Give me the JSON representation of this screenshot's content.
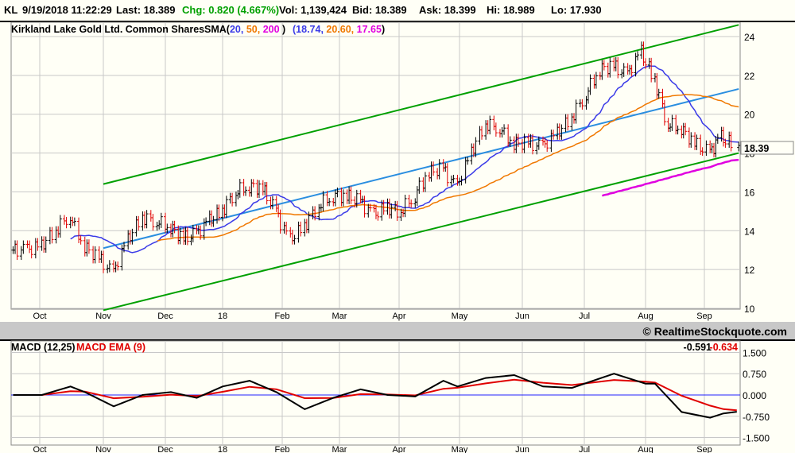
{
  "header": {
    "symbol": "KL",
    "datetime": "9/19/2018 11:22:29",
    "last": "Last: 18.389",
    "chg": "Chg: 0.820 (4.667%)",
    "vol": "Vol: 1,139,424",
    "bid": "Bid: 18.389",
    "ask": "Ask: 18.399",
    "hi": "Hi: 18.989",
    "lo": "Lo: 17.930"
  },
  "colors": {
    "up": "#000000",
    "down": "#e00000",
    "sma20": "#3a3ae8",
    "sma50": "#f07800",
    "sma200": "#e000e0",
    "channel": "#00a000",
    "midline": "#2a8ee0",
    "macd": "#000000",
    "signal": "#e00000",
    "zero": "#2020ff",
    "chg": "#00a000"
  },
  "chart_data": [
    {
      "type": "ohlc",
      "title": "Kirkland Lake Gold Ltd. Common Shares",
      "sma": {
        "label": "SMA(",
        "periods": [
          "20,",
          "50,",
          "200"
        ],
        "close": ")",
        "values": [
          "(18.74,",
          "20.60,",
          "17.65",
          ")"
        ]
      },
      "last_label": "18.39",
      "ylim": [
        10,
        24
      ],
      "yticks": [
        "10",
        "12",
        "14",
        "16",
        "18",
        "20",
        "22",
        "24"
      ],
      "xticks": [
        "Oct",
        "Nov",
        "Dec",
        "18",
        "Feb",
        "Mar",
        "Apr",
        "May",
        "Jun",
        "Jul",
        "Aug",
        "Sep"
      ],
      "weekly_close": {
        "dates": [
          "2017-09-18",
          "2017-09-25",
          "2017-10-02",
          "2017-10-09",
          "2017-10-16",
          "2017-10-23",
          "2017-10-30",
          "2017-11-06",
          "2017-11-13",
          "2017-11-20",
          "2017-11-27",
          "2017-12-04",
          "2017-12-11",
          "2017-12-18",
          "2017-12-25",
          "2018-01-01",
          "2018-01-08",
          "2018-01-15",
          "2018-01-22",
          "2018-01-29",
          "2018-02-05",
          "2018-02-12",
          "2018-02-19",
          "2018-02-26",
          "2018-03-05",
          "2018-03-12",
          "2018-03-19",
          "2018-03-26",
          "2018-04-02",
          "2018-04-09",
          "2018-04-16",
          "2018-04-23",
          "2018-04-30",
          "2018-05-07",
          "2018-05-14",
          "2018-05-21",
          "2018-05-28",
          "2018-06-04",
          "2018-06-11",
          "2018-06-18",
          "2018-06-25",
          "2018-07-02",
          "2018-07-09",
          "2018-07-16",
          "2018-07-23",
          "2018-07-30",
          "2018-08-06",
          "2018-08-13",
          "2018-08-20",
          "2018-08-27",
          "2018-09-04",
          "2018-09-10",
          "2018-09-17"
        ],
        "values": [
          13.0,
          13.0,
          13.2,
          14.0,
          14.8,
          13.2,
          12.6,
          11.8,
          13.5,
          14.7,
          14.5,
          14.2,
          13.6,
          13.8,
          14.5,
          15.0,
          16.0,
          16.3,
          16.2,
          15.0,
          13.5,
          14.2,
          15.3,
          15.8,
          15.8,
          15.5,
          14.8,
          15.2,
          15.0,
          15.8,
          17.0,
          17.2,
          16.2,
          18.0,
          19.5,
          19.3,
          18.5,
          18.5,
          18.3,
          19.0,
          19.8,
          21.0,
          22.3,
          22.5,
          22.0,
          23.2,
          21.8,
          19.5,
          19.3,
          18.5,
          18.0,
          18.8,
          18.39
        ]
      },
      "trendlines": [
        {
          "kind": "upper",
          "from": [
            "2017-11-01",
            16.4
          ],
          "to": [
            "2018-09-19",
            24.6
          ]
        },
        {
          "kind": "middle",
          "from": [
            "2017-11-01",
            13.1
          ],
          "to": [
            "2018-09-19",
            21.3
          ]
        },
        {
          "kind": "lower",
          "from": [
            "2017-11-01",
            9.9
          ],
          "to": [
            "2018-09-19",
            18.0
          ]
        }
      ]
    },
    {
      "type": "line",
      "title": "MACD (12,25)",
      "signal_title": "MACD EMA (9)",
      "macd_value": "-0.591",
      "signal_value": "-0.634",
      "ylim": [
        -1.5,
        1.5
      ],
      "yticks": [
        "1.500",
        "0.750",
        "0.000",
        "-0.750",
        "-1.500"
      ],
      "xticks": [
        "Oct",
        "Nov",
        "Dec",
        "18",
        "Feb",
        "Mar",
        "Apr",
        "May",
        "Jun",
        "Jul",
        "Aug",
        "Sep"
      ],
      "macd": {
        "dates": [
          "2017-09-18",
          "2017-10-02",
          "2017-10-16",
          "2017-10-23",
          "2017-11-06",
          "2017-11-20",
          "2017-12-04",
          "2017-12-18",
          "2018-01-01",
          "2018-01-15",
          "2018-01-29",
          "2018-02-12",
          "2018-02-26",
          "2018-03-12",
          "2018-03-26",
          "2018-04-09",
          "2018-04-23",
          "2018-04-30",
          "2018-05-14",
          "2018-05-28",
          "2018-06-11",
          "2018-06-25",
          "2018-07-16",
          "2018-08-01",
          "2018-08-06",
          "2018-08-20",
          "2018-09-04",
          "2018-09-11",
          "2018-09-18"
        ],
        "values": [
          0.0,
          0.0,
          0.3,
          0.1,
          -0.4,
          0.0,
          0.1,
          -0.1,
          0.3,
          0.5,
          0.1,
          -0.5,
          -0.1,
          0.2,
          0.0,
          -0.05,
          0.5,
          0.3,
          0.6,
          0.7,
          0.3,
          0.25,
          0.75,
          0.4,
          0.4,
          -0.6,
          -0.8,
          -0.65,
          -0.59
        ]
      }
    },
    {
      "footer": "© RealtimeStockquote.com"
    }
  ]
}
